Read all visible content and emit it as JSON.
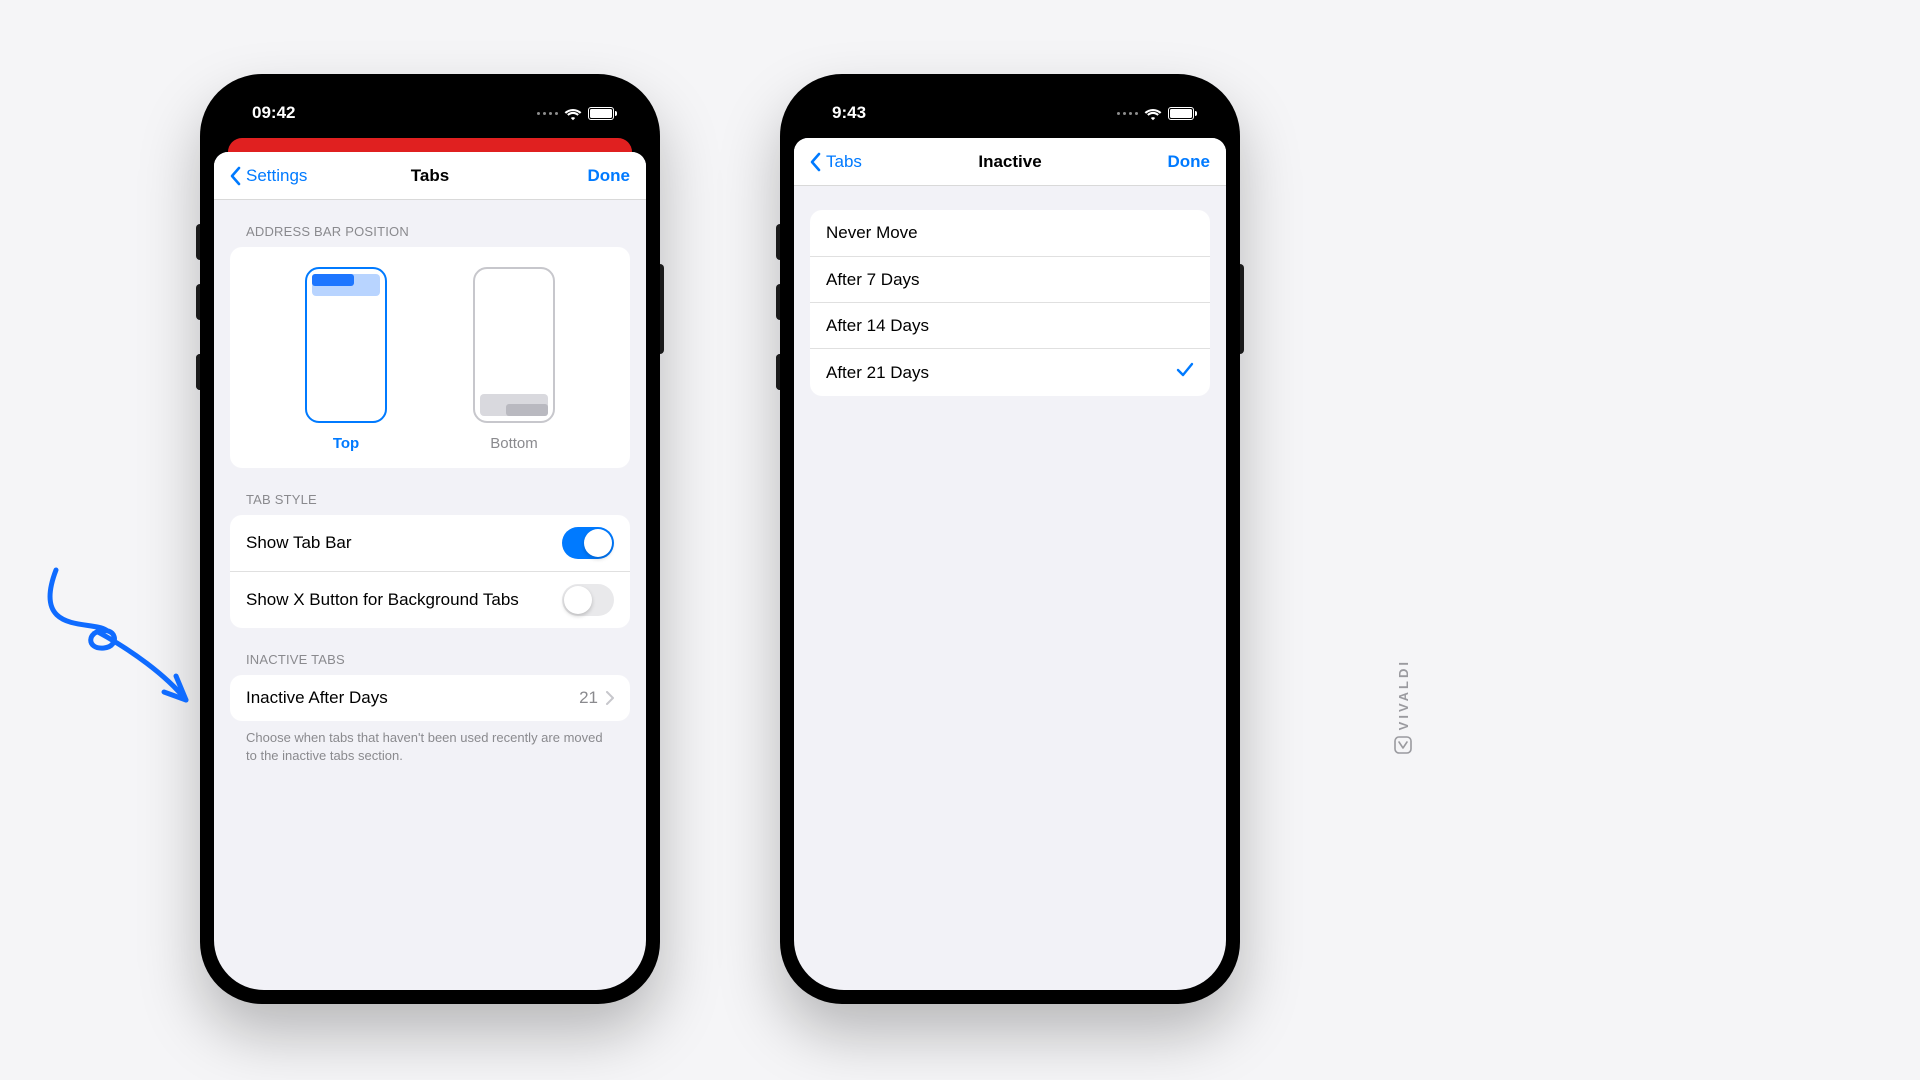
{
  "colors": {
    "accent": "#007aff",
    "redStrip": "#e02020"
  },
  "watermark": "VIVALDI",
  "phone1": {
    "statusTime": "09:42",
    "nav": {
      "back": "Settings",
      "title": "Tabs",
      "done": "Done"
    },
    "sections": {
      "addressBar": {
        "header": "ADDRESS BAR POSITION",
        "options": [
          {
            "label": "Top",
            "selected": true
          },
          {
            "label": "Bottom",
            "selected": false
          }
        ]
      },
      "tabStyle": {
        "header": "TAB STYLE",
        "rows": [
          {
            "label": "Show Tab Bar",
            "toggle": true
          },
          {
            "label": "Show X Button for Background Tabs",
            "toggle": false
          }
        ]
      },
      "inactiveTabs": {
        "header": "INACTIVE TABS",
        "row": {
          "label": "Inactive After Days",
          "value": "21"
        },
        "footer": "Choose when tabs that haven't been used recently are moved to the inactive tabs section."
      }
    }
  },
  "phone2": {
    "statusTime": "9:43",
    "nav": {
      "back": "Tabs",
      "title": "Inactive",
      "done": "Done"
    },
    "options": [
      {
        "label": "Never Move",
        "selected": false
      },
      {
        "label": "After 7 Days",
        "selected": false
      },
      {
        "label": "After 14 Days",
        "selected": false
      },
      {
        "label": "After 21 Days",
        "selected": true
      }
    ]
  }
}
